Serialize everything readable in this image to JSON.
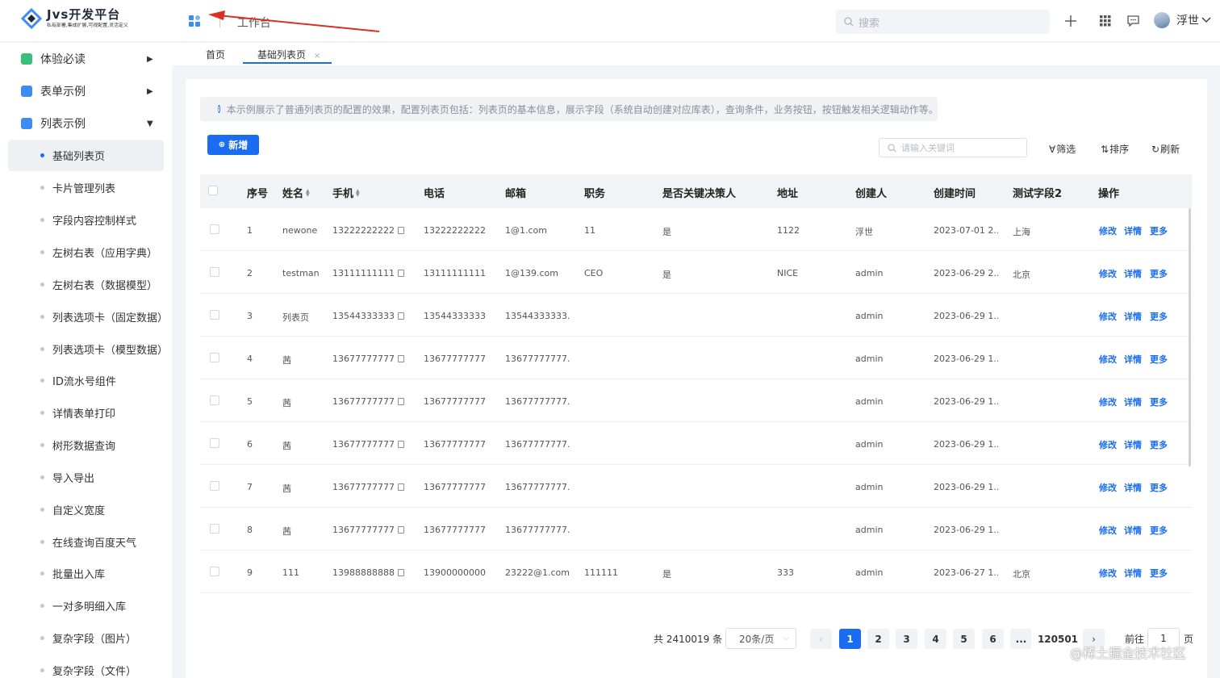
{
  "app": {
    "logo_title": "Jvs开发平台",
    "logo_slogan": "私有部署,集成扩展,可视配置,灵活定义",
    "workbench": "工作台",
    "search_placeholder": "搜索",
    "user_name": "浮世",
    "brand_color": "#1a6df2"
  },
  "sidebar": {
    "groups": [
      {
        "label": "体验必读",
        "icon": "book-icon",
        "icon_color": "#3bbf7a",
        "expanded": false
      },
      {
        "label": "表单示例",
        "icon": "folder-icon",
        "icon_color": "#3d8cf0",
        "expanded": false
      },
      {
        "label": "列表示例",
        "icon": "list-icon",
        "icon_color": "#3d8cf0",
        "expanded": true
      }
    ],
    "items": [
      {
        "label": "基础列表页",
        "active": true
      },
      {
        "label": "卡片管理列表"
      },
      {
        "label": "字段内容控制样式"
      },
      {
        "label": "左树右表（应用字典）"
      },
      {
        "label": "左树右表（数据模型）"
      },
      {
        "label": "列表选项卡（固定数据）"
      },
      {
        "label": "列表选项卡（模型数据）"
      },
      {
        "label": "ID流水号组件"
      },
      {
        "label": "详情表单打印"
      },
      {
        "label": "树形数据查询"
      },
      {
        "label": "导入导出"
      },
      {
        "label": "自定义宽度"
      },
      {
        "label": "在线查询百度天气"
      },
      {
        "label": "批量出入库"
      },
      {
        "label": "一对多明细入库"
      },
      {
        "label": "复杂字段（图片）"
      },
      {
        "label": "复杂字段（文件）"
      }
    ]
  },
  "tabs": [
    {
      "label": "首页"
    },
    {
      "label": "基础列表页",
      "close": "×",
      "active": true
    }
  ],
  "notice": "本示例展示了普通列表页的配置的效果，配置列表页包括：列表页的基本信息，展示字段（系统自动创建对应库表），查询条件，业务按钮，按钮触发相关逻辑动作等。",
  "toolbar": {
    "add_label": "新增",
    "keyword_placeholder": "请输入关键词",
    "filter_label": "筛选",
    "sort_label": "排序",
    "refresh_label": "刷新"
  },
  "table": {
    "columns": [
      "序号",
      "姓名",
      "手机",
      "电话",
      "邮箱",
      "职务",
      "是否关键决策人",
      "地址",
      "创建人",
      "创建时间",
      "测试字段2",
      "操作"
    ],
    "actions": [
      "修改",
      "详情",
      "更多"
    ],
    "rows": [
      {
        "no": "1",
        "name": "newone",
        "mobile": "13222222222",
        "phone": "13222222222",
        "email": "1@1.com",
        "title": "11",
        "key": "是",
        "addr": "1122",
        "creator": "浮世",
        "created": "2023-07-01 2...",
        "f2": "上海"
      },
      {
        "no": "2",
        "name": "testman",
        "mobile": "13111111111",
        "phone": "13111111111",
        "email": "1@139.com",
        "title": "CEO",
        "key": "是",
        "addr": "NICE",
        "creator": "admin",
        "created": "2023-06-29 2...",
        "f2": "北京"
      },
      {
        "no": "3",
        "name": "列表页",
        "mobile": "13544333333",
        "phone": "13544333333",
        "email": "13544333333...",
        "title": "",
        "key": "",
        "addr": "",
        "creator": "admin",
        "created": "2023-06-29 1...",
        "f2": ""
      },
      {
        "no": "4",
        "name": "茜",
        "mobile": "13677777777",
        "phone": "13677777777",
        "email": "13677777777...",
        "title": "",
        "key": "",
        "addr": "",
        "creator": "admin",
        "created": "2023-06-29 1...",
        "f2": ""
      },
      {
        "no": "5",
        "name": "茜",
        "mobile": "13677777777",
        "phone": "13677777777",
        "email": "13677777777...",
        "title": "",
        "key": "",
        "addr": "",
        "creator": "admin",
        "created": "2023-06-29 1...",
        "f2": ""
      },
      {
        "no": "6",
        "name": "茜",
        "mobile": "13677777777",
        "phone": "13677777777",
        "email": "13677777777...",
        "title": "",
        "key": "",
        "addr": "",
        "creator": "admin",
        "created": "2023-06-29 1...",
        "f2": ""
      },
      {
        "no": "7",
        "name": "茜",
        "mobile": "13677777777",
        "phone": "13677777777",
        "email": "13677777777...",
        "title": "",
        "key": "",
        "addr": "",
        "creator": "admin",
        "created": "2023-06-29 1...",
        "f2": ""
      },
      {
        "no": "8",
        "name": "茜",
        "mobile": "13677777777",
        "phone": "13677777777",
        "email": "13677777777...",
        "title": "",
        "key": "",
        "addr": "",
        "creator": "admin",
        "created": "2023-06-29 1...",
        "f2": ""
      },
      {
        "no": "9",
        "name": "111",
        "mobile": "13988888888",
        "phone": "13900000000",
        "email": "23222@1.com",
        "title": "111111",
        "key": "是",
        "addr": "333",
        "creator": "admin",
        "created": "2023-06-27 1...",
        "f2": "北京"
      }
    ]
  },
  "pagination": {
    "total": "共 2410019 条",
    "page_size": "20条/页",
    "pages": [
      "1",
      "2",
      "3",
      "4",
      "5",
      "6",
      "...",
      "120501"
    ],
    "current": "1",
    "goto_label": "前往",
    "goto_value": "1",
    "goto_suffix": "页"
  },
  "watermark": "@稀土掘金技术社区"
}
